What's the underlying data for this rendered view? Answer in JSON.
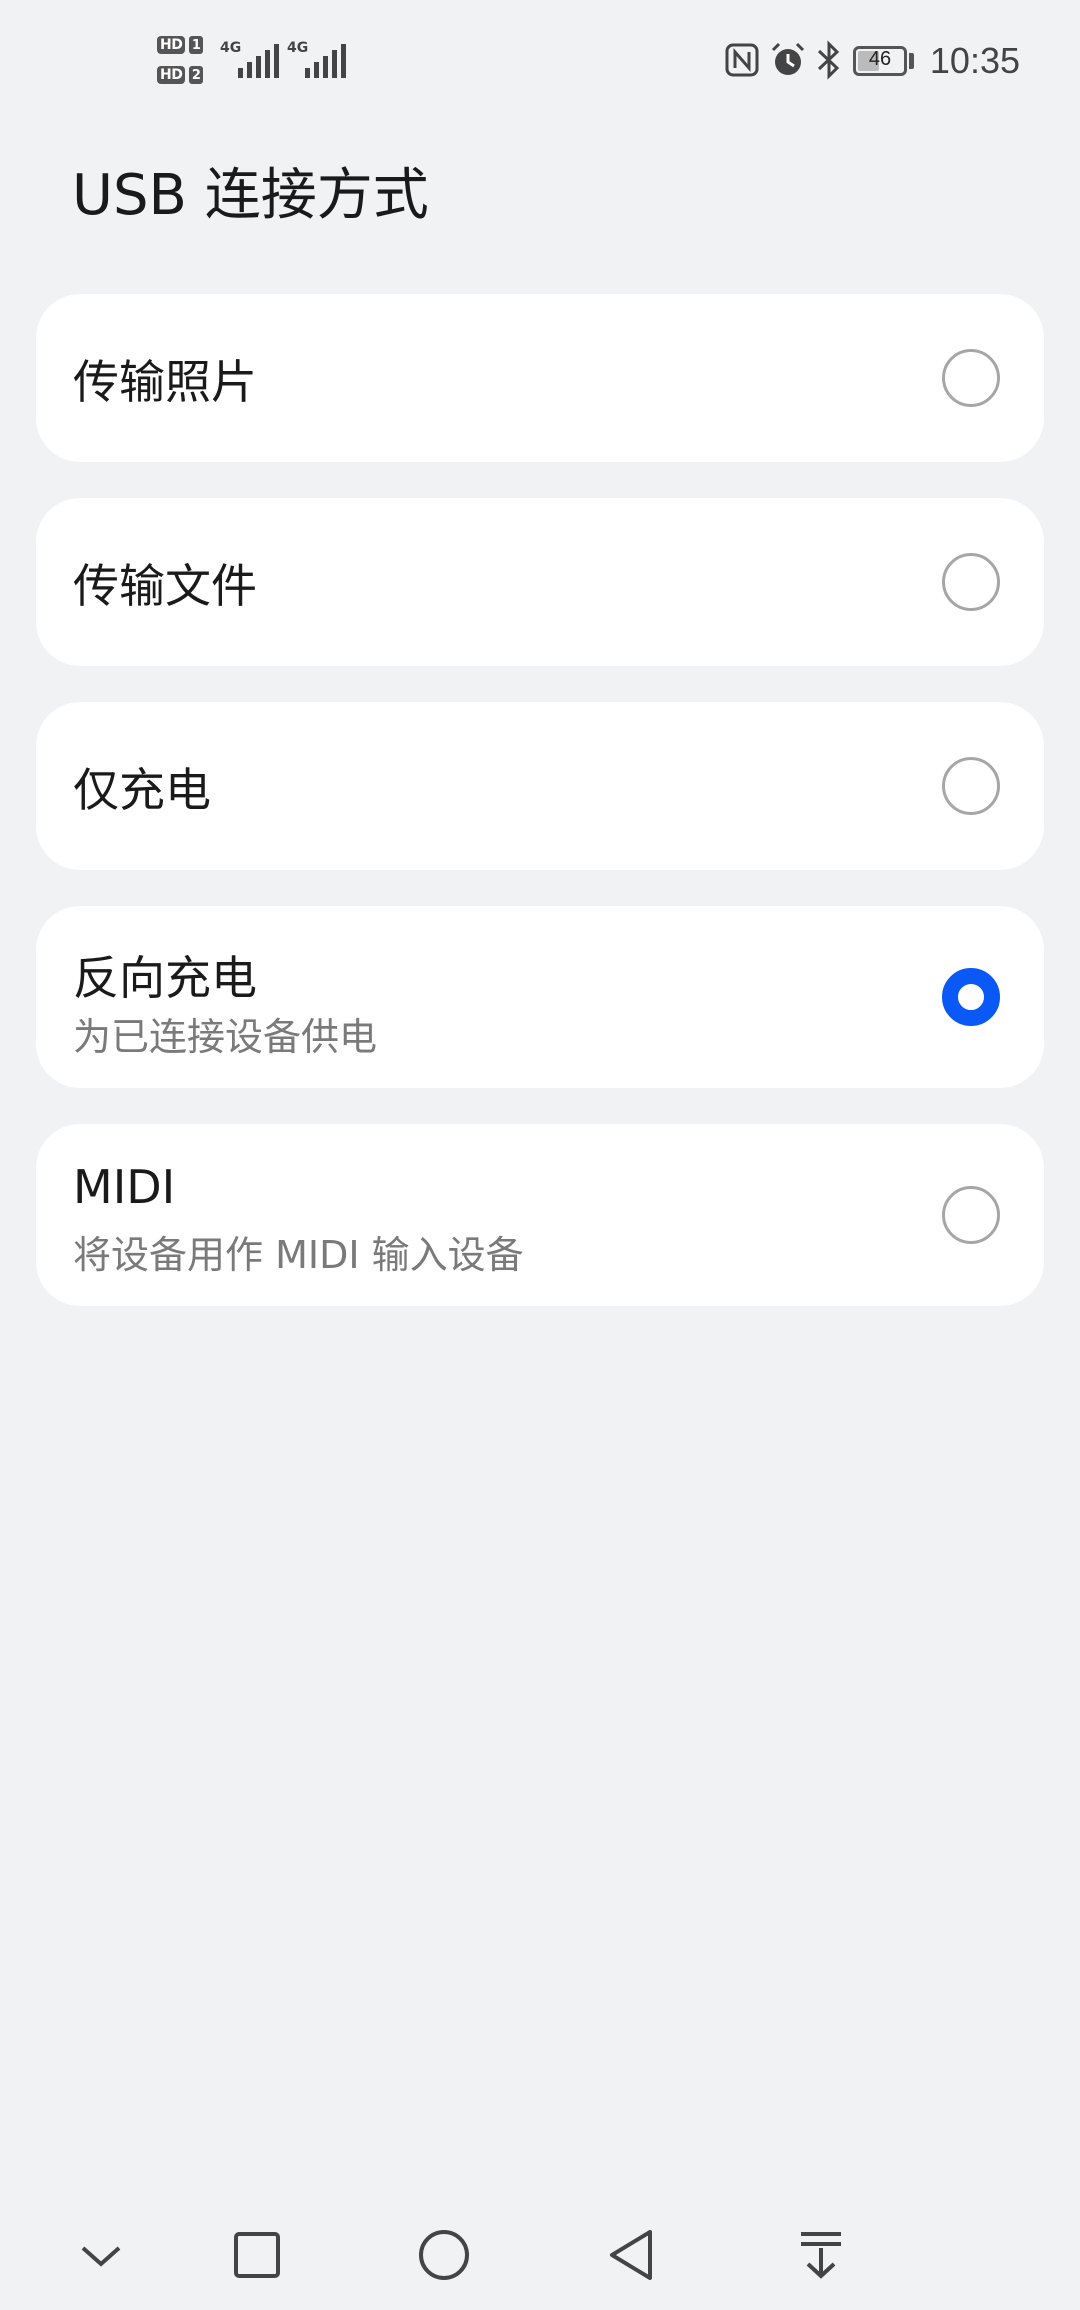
{
  "status_bar": {
    "sim1_badge": "HD",
    "sim1_num": "1",
    "sim2_badge": "HD",
    "sim2_num": "2",
    "sim1_network": "4G",
    "sim2_network": "4G",
    "battery_level": "46",
    "time": "10:35",
    "icons": [
      "nfc-icon",
      "alarm-icon",
      "bluetooth-icon",
      "battery-icon"
    ]
  },
  "page": {
    "title": "USB 连接方式"
  },
  "options": [
    {
      "label": "传输照片",
      "subtitle": "",
      "selected": false
    },
    {
      "label": "传输文件",
      "subtitle": "",
      "selected": false
    },
    {
      "label": "仅充电",
      "subtitle": "",
      "selected": false
    },
    {
      "label": "反向充电",
      "subtitle": "为已连接设备供电",
      "selected": true
    },
    {
      "label": "MIDI",
      "subtitle": "将设备用作 MIDI 输入设备",
      "selected": false
    }
  ],
  "nav_bar": {
    "icons": [
      "collapse-icon",
      "recents-icon",
      "home-icon",
      "back-icon",
      "notification-pull-icon"
    ]
  },
  "colors": {
    "accent": "#0a59f7",
    "background": "#f1f2f4",
    "card": "#ffffff"
  }
}
